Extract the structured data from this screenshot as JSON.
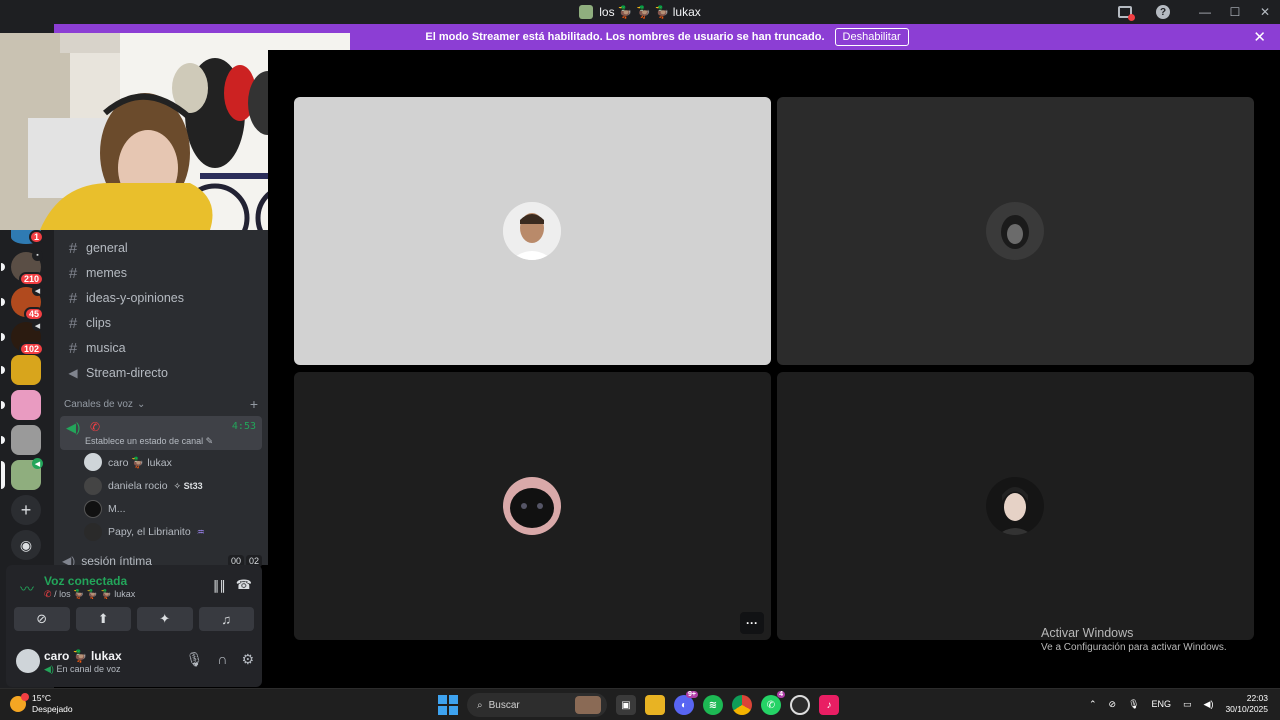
{
  "window": {
    "title": "los 🦆 🦆 🦆 lukax"
  },
  "banner": {
    "message": "El modo Streamer está habilitado. Los nombres de usuario se han truncado.",
    "button": "Deshabilitar"
  },
  "notifications": {
    "total": "513"
  },
  "servers": [
    {
      "badge": "1"
    },
    {
      "badge": "210"
    },
    {
      "badge": "45"
    },
    {
      "badge": "102"
    },
    {
      "badge": ""
    },
    {
      "badge": ""
    },
    {
      "badge": ""
    },
    {
      "badge": ""
    }
  ],
  "channels": [
    {
      "type": "text",
      "label": "general"
    },
    {
      "type": "text",
      "label": "memes"
    },
    {
      "type": "text",
      "label": "ideas-y-opiniones"
    },
    {
      "type": "text",
      "label": "clips"
    },
    {
      "type": "text",
      "label": "musica"
    },
    {
      "type": "stage",
      "label": "Stream-directo"
    }
  ],
  "voice_category": {
    "label": "Canales de voz"
  },
  "active_voice": {
    "timer": "4:53",
    "status_placeholder": "Establece un estado de canal",
    "members": [
      {
        "name": "caro 🦆 lukax",
        "tag": ""
      },
      {
        "name": "daniela rocio",
        "tag": "St33"
      },
      {
        "name": "M...",
        "tag": ""
      },
      {
        "name": "Papy, el Librianito",
        "tag": ""
      }
    ]
  },
  "other_voice": {
    "label": "sesión íntima",
    "count": "00",
    "limit": "02"
  },
  "voice_panel": {
    "title": "Voz conectada",
    "subtitle": "/ los 🦆 🦆 🦆 lukax"
  },
  "user": {
    "name": "caro 🦆 lukax",
    "status": "En canal de voz"
  },
  "watermark": {
    "line1": "Activar Windows",
    "line2": "Ve a Configuración para activar Windows."
  },
  "taskbar": {
    "weather_temp": "15°C",
    "weather_desc": "Despejado",
    "search": "Buscar",
    "discord_badge": "9+",
    "whatsapp_badge": "4",
    "lang": "ENG",
    "time": "22:03",
    "date": "30/10/2025"
  },
  "colors": {
    "accent": "#8c3ed4",
    "voice_green": "#23a55a",
    "danger": "#f23f43"
  }
}
